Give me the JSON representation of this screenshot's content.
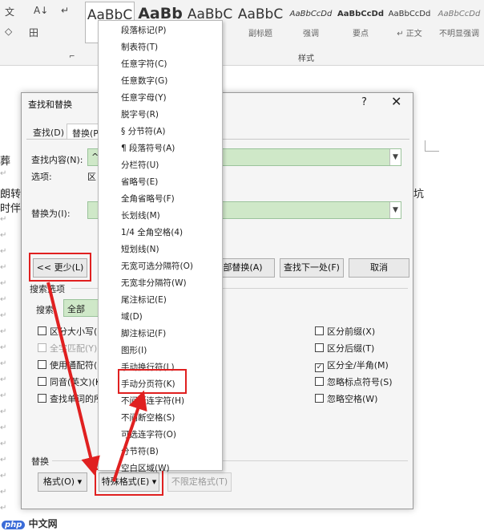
{
  "ribbon": {
    "styles": [
      {
        "sample": "AaBbC",
        "caption": ""
      },
      {
        "sample": "AaBb",
        "caption": ""
      },
      {
        "sample": "AaBbC",
        "caption": ""
      },
      {
        "sample": "AaBbC",
        "caption": "副标题"
      },
      {
        "sample": "AaBbCcDd",
        "caption": "强调"
      },
      {
        "sample": "AaBbCcDd",
        "caption": "要点"
      },
      {
        "sample": "AaBbCcDd",
        "caption": "↵ 正文"
      },
      {
        "sample": "AaBbCcDd",
        "caption": "不明显强调"
      }
    ],
    "group_label": "样式",
    "icons": [
      "文",
      "A↓",
      "↵",
      "◇",
      "田",
      "⌐"
    ]
  },
  "document": {
    "lines": [
      "葬",
      "朗转",
      "时伴"
    ],
    "right_text": "坑",
    "para_mark": "↵"
  },
  "dialog": {
    "title": "查找和替换",
    "help": "?",
    "close": "✕",
    "tabs": [
      "查找(D)",
      "替换(P"
    ],
    "find_label": "查找内容(N):",
    "find_value": "^",
    "options_label": "选项:",
    "options_value": "区",
    "replace_label": "替换为(I):",
    "buttons": {
      "less": "<< 更少(L)",
      "replace_all": "部替换(A)",
      "find_next": "查找下一处(F)",
      "cancel": "取消"
    },
    "search_options_title": "搜索选项",
    "search_label": "搜索:",
    "search_value": "全部",
    "left_checks": [
      {
        "label": "区分大小写(",
        "checked": false,
        "disabled": false
      },
      {
        "label": "全字匹配(Y)",
        "checked": false,
        "disabled": true
      },
      {
        "label": "使用通配符(",
        "checked": false,
        "disabled": false
      },
      {
        "label": "同音(英文)(K",
        "checked": false,
        "disabled": false
      },
      {
        "label": "查找单词的所",
        "checked": false,
        "disabled": false
      }
    ],
    "right_checks": [
      {
        "label": "区分前缀(X)",
        "checked": false
      },
      {
        "label": "区分后缀(T)",
        "checked": false
      },
      {
        "label": "区分全/半角(M)",
        "checked": true
      },
      {
        "label": "忽略标点符号(S)",
        "checked": false
      },
      {
        "label": "忽略空格(W)",
        "checked": false
      }
    ],
    "replace_section": "替换",
    "format_button": "格式(O) ▾",
    "special_button": "特殊格式(E) ▾",
    "no_format_button": "不限定格式(T)"
  },
  "menu": {
    "items": [
      "段落标记(P)",
      "制表符(T)",
      "任意字符(C)",
      "任意数字(G)",
      "任意字母(Y)",
      "脱字号(R)",
      "§ 分节符(A)",
      "¶ 段落符号(A)",
      "分栏符(U)",
      "省略号(E)",
      "全角省略号(F)",
      "长划线(M)",
      "1/4 全角空格(4)",
      "短划线(N)",
      "无宽可选分隔符(O)",
      "无宽非分隔符(W)",
      "尾注标记(E)",
      "域(D)",
      "脚注标记(F)",
      "图形(I)",
      "手动换行符(L)",
      "手动分页符(K)",
      "不间断连字符(H)",
      "不间断空格(S)",
      "可选连字符(O)",
      "分节符(B)",
      "空白区域(W)"
    ]
  },
  "watermark": {
    "badge": "php",
    "text": "中文网"
  },
  "colors": {
    "highlight": "#e02020",
    "field_green": "#cfe8c8"
  }
}
